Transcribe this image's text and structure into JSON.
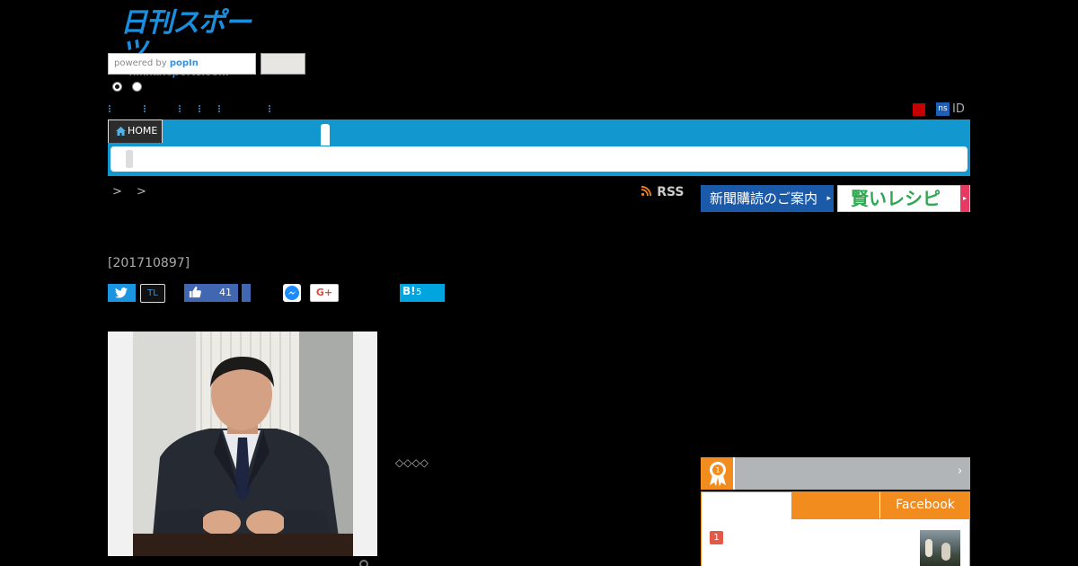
{
  "header": {
    "logo_jp": "日刊スポーツ",
    "logo_en_a": "nikkan",
    "logo_en_b": "s",
    "logo_en_c": "ports.com"
  },
  "search": {
    "powered_by": "powered by ",
    "provider": "popIn"
  },
  "account": {
    "ns_badge": "ns",
    "id_label": "ID"
  },
  "nav": {
    "home_label": "HOME"
  },
  "breadcrumb": {
    "separator_text": "> >"
  },
  "rss": {
    "label": "RSS"
  },
  "banners": {
    "subscription": "新聞購読のご案内",
    "recipe": "賢いレシピ"
  },
  "article": {
    "id": "[201710897]",
    "diamonds": "◇◇◇◇"
  },
  "social": {
    "timeline_label": "TL",
    "like_count": "41",
    "gplus_label": "G+",
    "hatena_label": "B!",
    "hatena_count": "5"
  },
  "ranking": {
    "arrow": "›",
    "tab_facebook": "Facebook",
    "first_rank": "1"
  },
  "colors": {
    "nav_blue": "#1397cf",
    "ranking_orange": "#f28c1e",
    "subscription_blue": "#1a5aa8"
  }
}
